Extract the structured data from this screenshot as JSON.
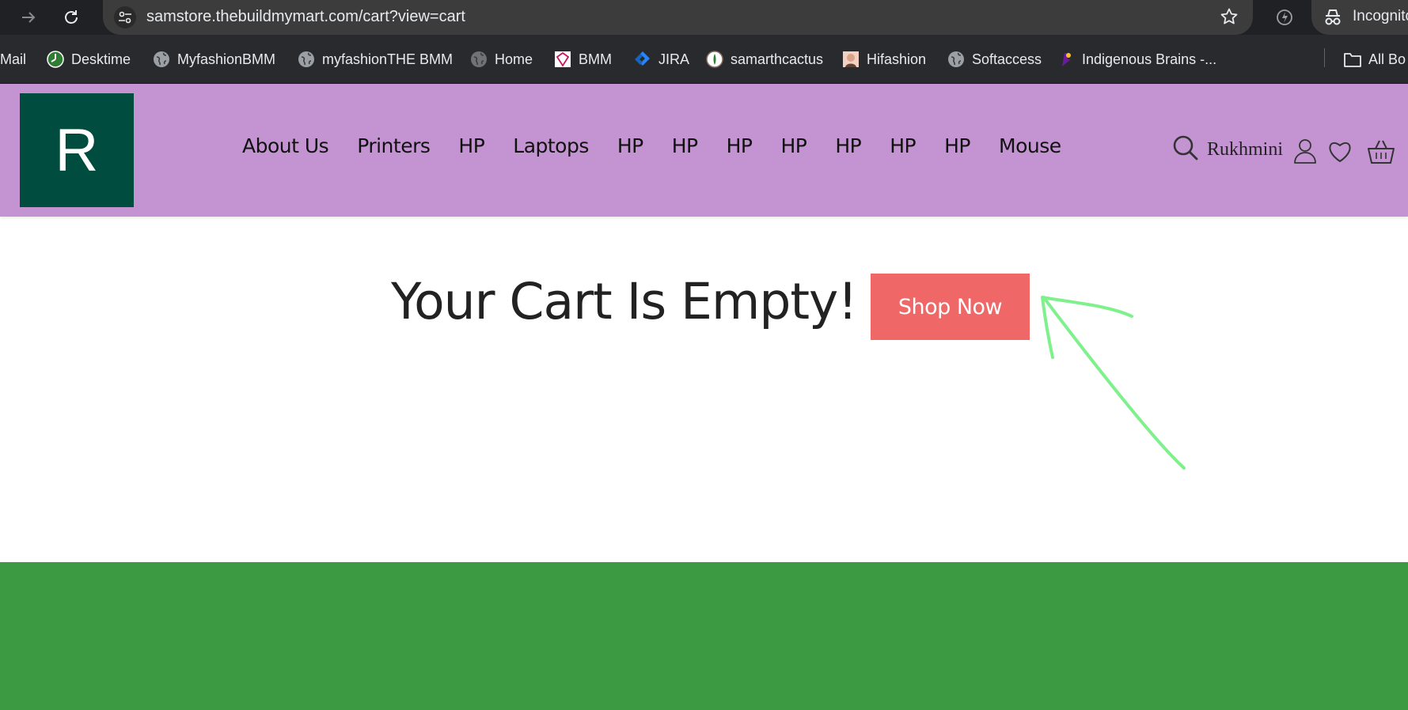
{
  "browser": {
    "url": "samstore.thebuildmymart.com/cart?view=cart",
    "incognito_label": "Incognito",
    "bookmarks": [
      {
        "label": "Mail",
        "icon": "none"
      },
      {
        "label": "Desktime",
        "icon": "desktime-icon"
      },
      {
        "label": "MyfashionBMM",
        "icon": "globe-icon"
      },
      {
        "label": "myfashionTHE BMM",
        "icon": "globe-icon"
      },
      {
        "label": "Home",
        "icon": "globe-icon"
      },
      {
        "label": "BMM",
        "icon": "bmm-icon"
      },
      {
        "label": "JIRA",
        "icon": "jira-icon"
      },
      {
        "label": "samarthcactus",
        "icon": "cactus-icon"
      },
      {
        "label": "Hifashion",
        "icon": "hifashion-icon"
      },
      {
        "label": "Softaccess",
        "icon": "globe-icon"
      },
      {
        "label": "Indigenous Brains -...",
        "icon": "indigenous-icon"
      }
    ],
    "all_bookmarks_label": "All Bo"
  },
  "header": {
    "logo_letter": "R",
    "nav": [
      "About Us",
      "Printers",
      "HP",
      "Laptops",
      "HP",
      "HP",
      "HP",
      "HP",
      "HP",
      "HP",
      "HP",
      "Mouse"
    ],
    "username": "Rukhmini",
    "colors": {
      "header_bg": "#c394d1",
      "logo_bg": "#004d40"
    }
  },
  "main": {
    "empty_title": "Your Cart Is Empty!",
    "shop_button": "Shop Now",
    "colors": {
      "button_bg": "#ef6767",
      "annotation": "#7ef08c",
      "footer_bg": "#3c9a43"
    }
  }
}
